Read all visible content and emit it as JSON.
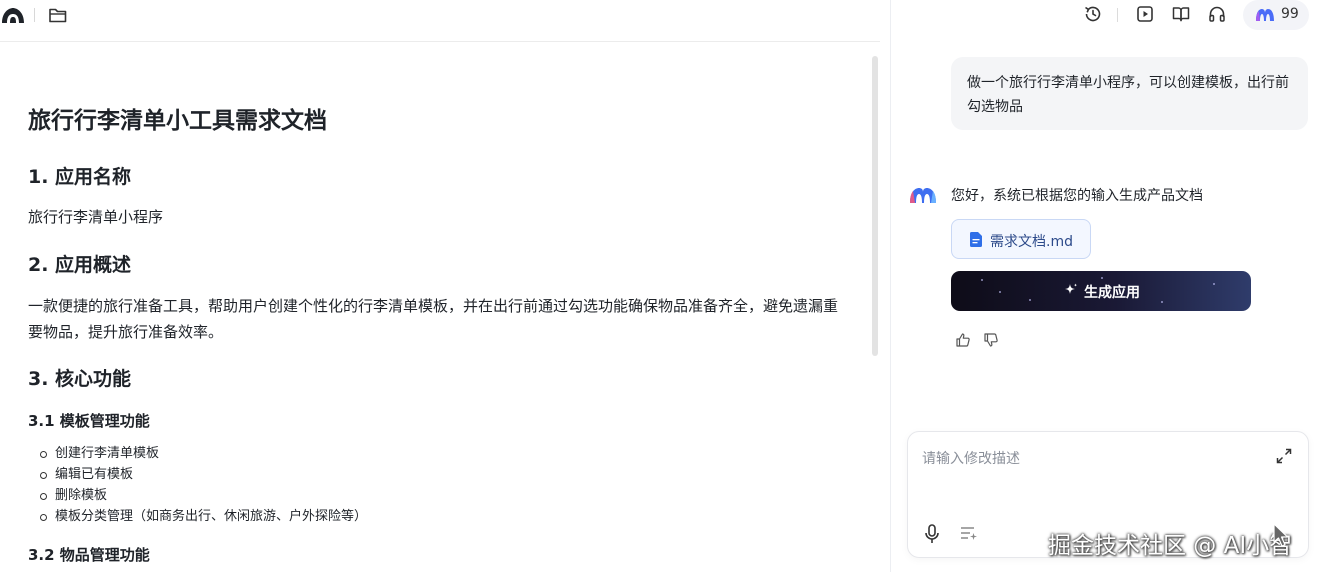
{
  "document": {
    "title": "旅行行李清单小工具需求文档",
    "section1_heading": "1. 应用名称",
    "section1_text": "旅行行李清单小程序",
    "section2_heading": "2. 应用概述",
    "section2_text": "一款便捷的旅行准备工具，帮助用户创建个性化的行李清单模板，并在出行前通过勾选功能确保物品准备齐全，避免遗漏重要物品，提升旅行准备效率。",
    "section3_heading": "3. 核心功能",
    "sub31_heading": "3.1 模板管理功能",
    "sub31_items": [
      "创建行李清单模板",
      "编辑已有模板",
      "删除模板",
      "模板分类管理（如商务出行、休闲旅游、户外探险等）"
    ],
    "sub32_heading": "3.2 物品管理功能"
  },
  "chat": {
    "credits": "99",
    "user_message": "做一个旅行行李清单小程序，可以创建模板，出行前勾选物品",
    "bot_message": "您好，系统已根据您的输入生成产品文档",
    "file_name": "需求文档.md",
    "generate_label": "生成应用",
    "input_placeholder": "请输入修改描述"
  },
  "watermark": "掘金技术社区 @ AI小智",
  "icons": {
    "top_left": [
      "app-logo-icon",
      "folder-icon"
    ],
    "top_right": [
      "history-icon",
      "play-icon",
      "book-icon",
      "headphones-icon",
      "model-logo-icon"
    ],
    "chat": [
      "bot-avatar-icon",
      "document-icon",
      "sparkle-icon",
      "thumbs-up-icon",
      "thumbs-down-icon",
      "expand-icon",
      "mic-icon",
      "prompt-list-icon"
    ]
  },
  "colors": {
    "accent_blue": "#2f6fe8",
    "button_dark": "#1a1935",
    "user_bubble": "#f4f5f7"
  }
}
